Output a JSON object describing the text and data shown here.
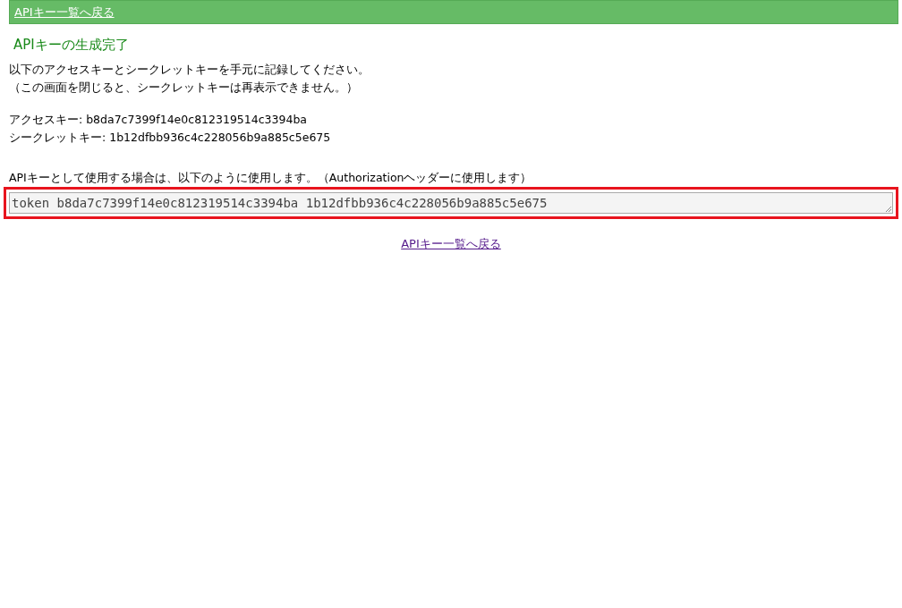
{
  "header": {
    "back_link": "APIキー一覧へ戻る"
  },
  "title": "APIキーの生成完了",
  "instructions": [
    "以下のアクセスキーとシークレットキーを手元に記録してください。",
    "（この画面を閉じると、シークレットキーは再表示できません。）"
  ],
  "keys": [
    {
      "label": "アクセスキー: b8da7c7399f14e0c812319514c3394ba"
    },
    {
      "label": "シークレットキー: 1b12dfbb936c4c228056b9a885c5e675"
    }
  ],
  "usage_note": "APIキーとして使用する場合は、以下のように使用します。（Authorizationヘッダーに使用します）",
  "token_field": {
    "value": "token b8da7c7399f14e0c812319514c3394ba 1b12dfbb936c4c228056b9a885c5e675",
    "highlighted": true
  },
  "footer_link": "APIキー一覧へ戻る"
}
